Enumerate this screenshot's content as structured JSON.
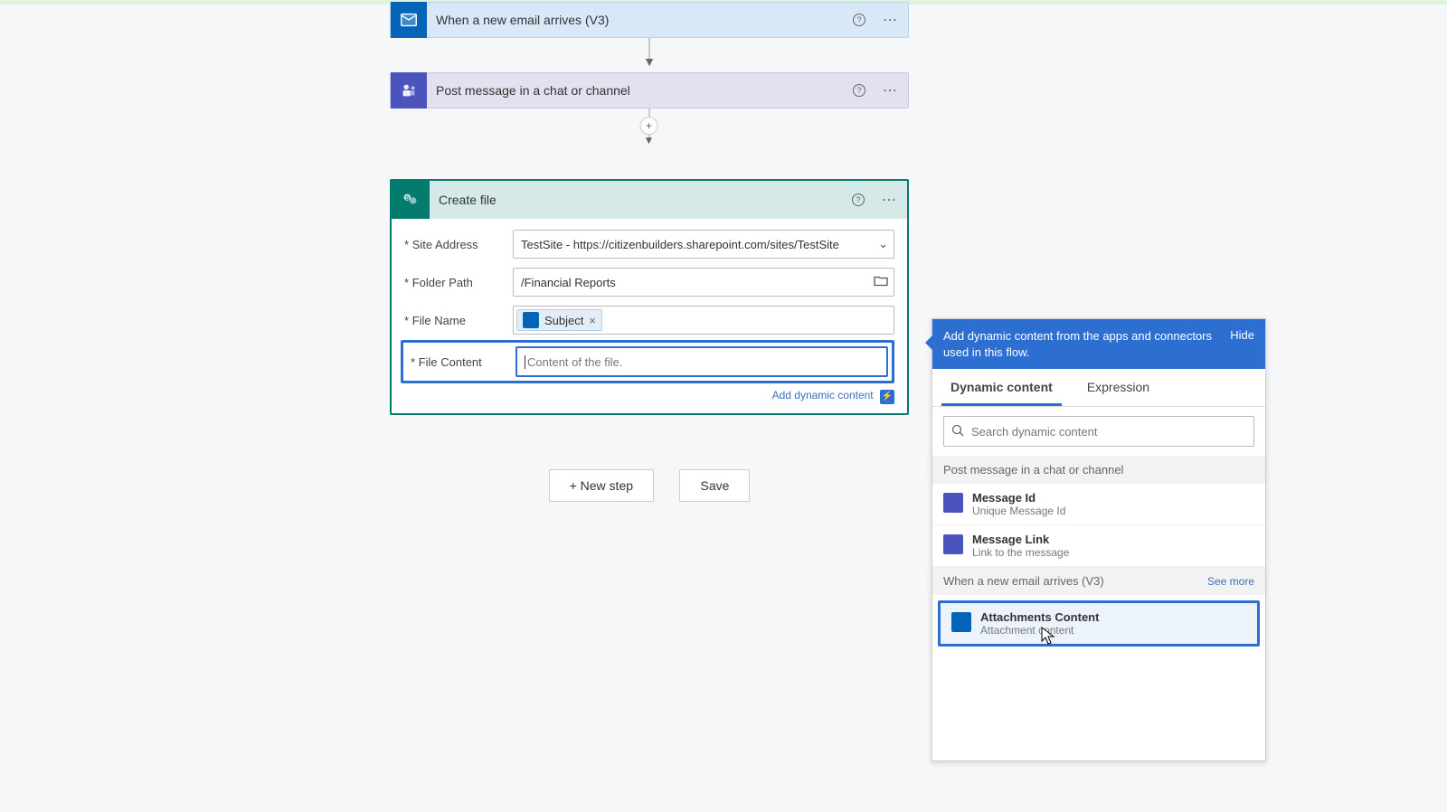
{
  "trigger": {
    "title": "When a new email arrives (V3)"
  },
  "action1": {
    "title": "Post message in a chat or channel"
  },
  "create": {
    "title": "Create file",
    "fields": {
      "siteAddress": {
        "label": "Site Address",
        "value": "TestSite - https://citizenbuilders.sharepoint.com/sites/TestSite"
      },
      "folderPath": {
        "label": "Folder Path",
        "value": "/Financial Reports"
      },
      "fileName": {
        "label": "File Name",
        "token": "Subject"
      },
      "fileContent": {
        "label": "File Content",
        "placeholder": "Content of the file."
      }
    },
    "addDynamic": "Add dynamic content"
  },
  "buttons": {
    "newStep": "+ New step",
    "save": "Save"
  },
  "flyout": {
    "desc": "Add dynamic content from the apps and connectors used in this flow.",
    "hide": "Hide",
    "tabs": {
      "dynamic": "Dynamic content",
      "expression": "Expression"
    },
    "searchPlaceholder": "Search dynamic content",
    "group1": {
      "title": "Post message in a chat or channel",
      "items": [
        {
          "name": "Message Id",
          "desc": "Unique Message Id"
        },
        {
          "name": "Message Link",
          "desc": "Link to the message"
        }
      ]
    },
    "group2": {
      "title": "When a new email arrives (V3)",
      "seeMore": "See more",
      "items": [
        {
          "name": "Attachments Content",
          "desc": "Attachment content"
        }
      ]
    }
  }
}
